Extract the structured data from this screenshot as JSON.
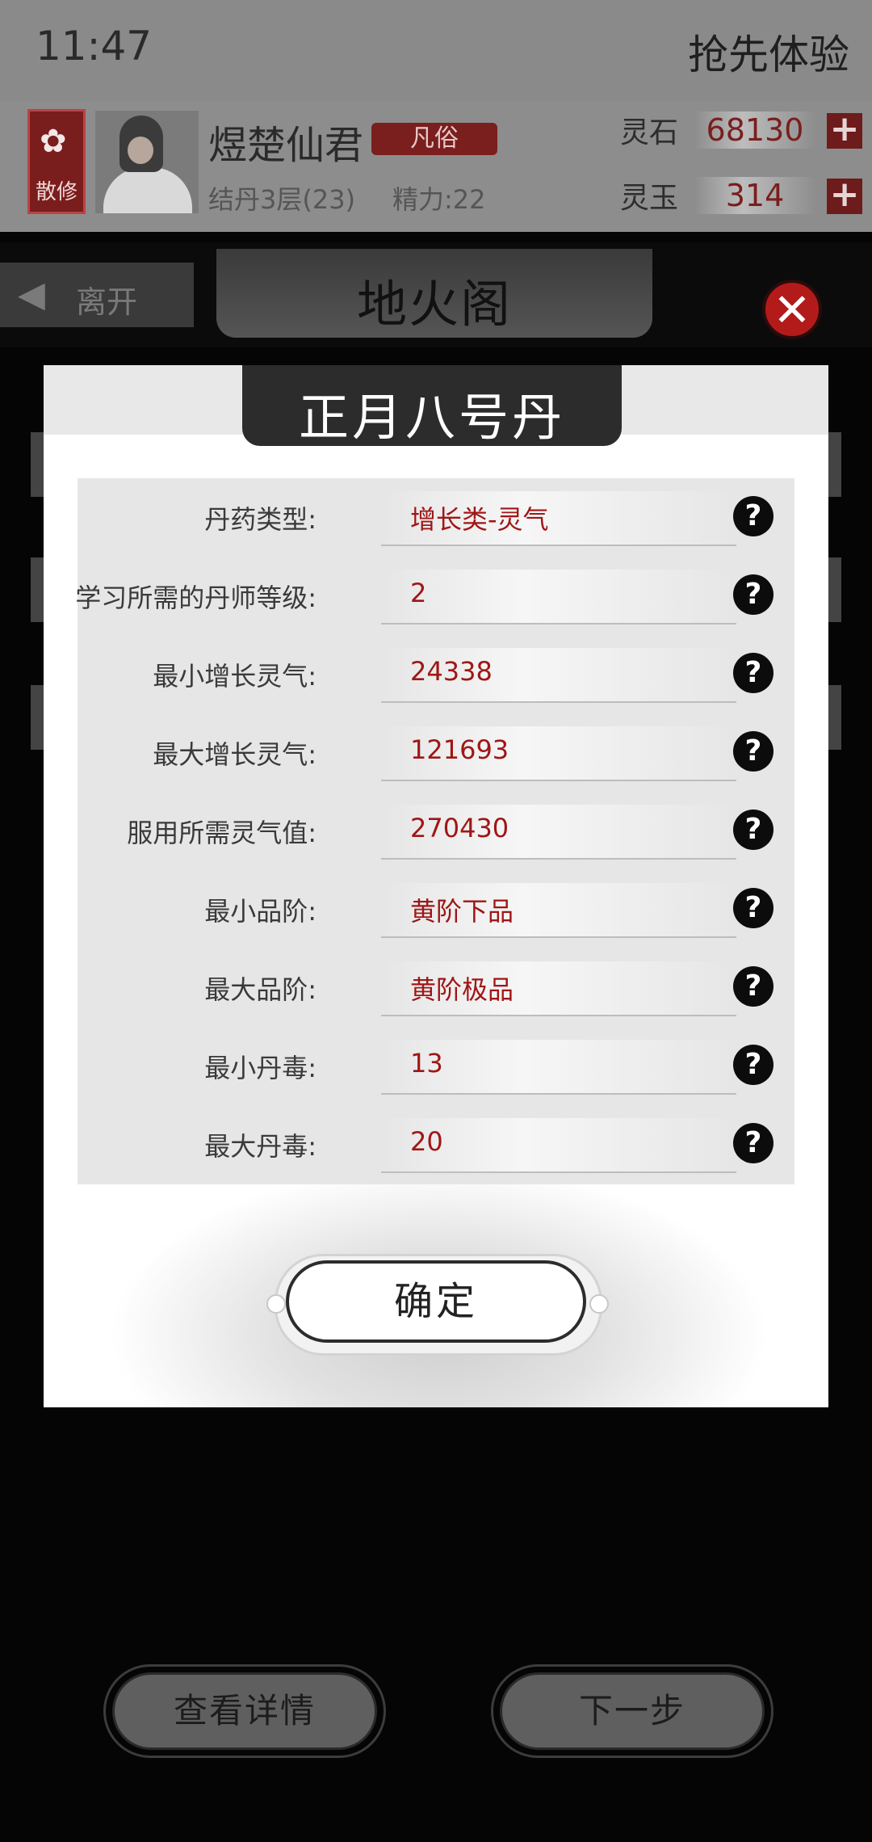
{
  "status": {
    "time": "11:47",
    "top_action": "抢先体验"
  },
  "player": {
    "sect_badge": "散修",
    "name": "煜楚仙君",
    "rank": "凡俗",
    "level": "结丹3层(23)",
    "energy": "精力:22"
  },
  "resources": [
    {
      "label": "灵石",
      "value": "68130"
    },
    {
      "label": "灵玉",
      "value": "314"
    }
  ],
  "nav": {
    "leave_label": "离开",
    "hall_title": "地火阁"
  },
  "modal": {
    "title": "正月八号丹",
    "rows": [
      {
        "label": "丹药类型:",
        "value": "增长类-灵气"
      },
      {
        "label": "学习所需的丹师等级:",
        "value": "2"
      },
      {
        "label": "最小增长灵气:",
        "value": "24338"
      },
      {
        "label": "最大增长灵气:",
        "value": "121693"
      },
      {
        "label": "服用所需灵气值:",
        "value": "270430"
      },
      {
        "label": "最小品阶:",
        "value": "黄阶下品"
      },
      {
        "label": "最大品阶:",
        "value": "黄阶极品"
      },
      {
        "label": "最小丹毒:",
        "value": "13"
      },
      {
        "label": "最大丹毒:",
        "value": "20"
      }
    ],
    "confirm_label": "确定"
  },
  "bottom": {
    "details_label": "查看详情",
    "next_label": "下一步"
  },
  "icons": {
    "help": "question-mark-icon",
    "close": "close-icon",
    "add": "plus-icon",
    "back": "back-arrow-icon"
  },
  "colors": {
    "accent_red": "#a01616",
    "badge_red": "#7a1d1d",
    "close_red": "#b31b1b"
  }
}
